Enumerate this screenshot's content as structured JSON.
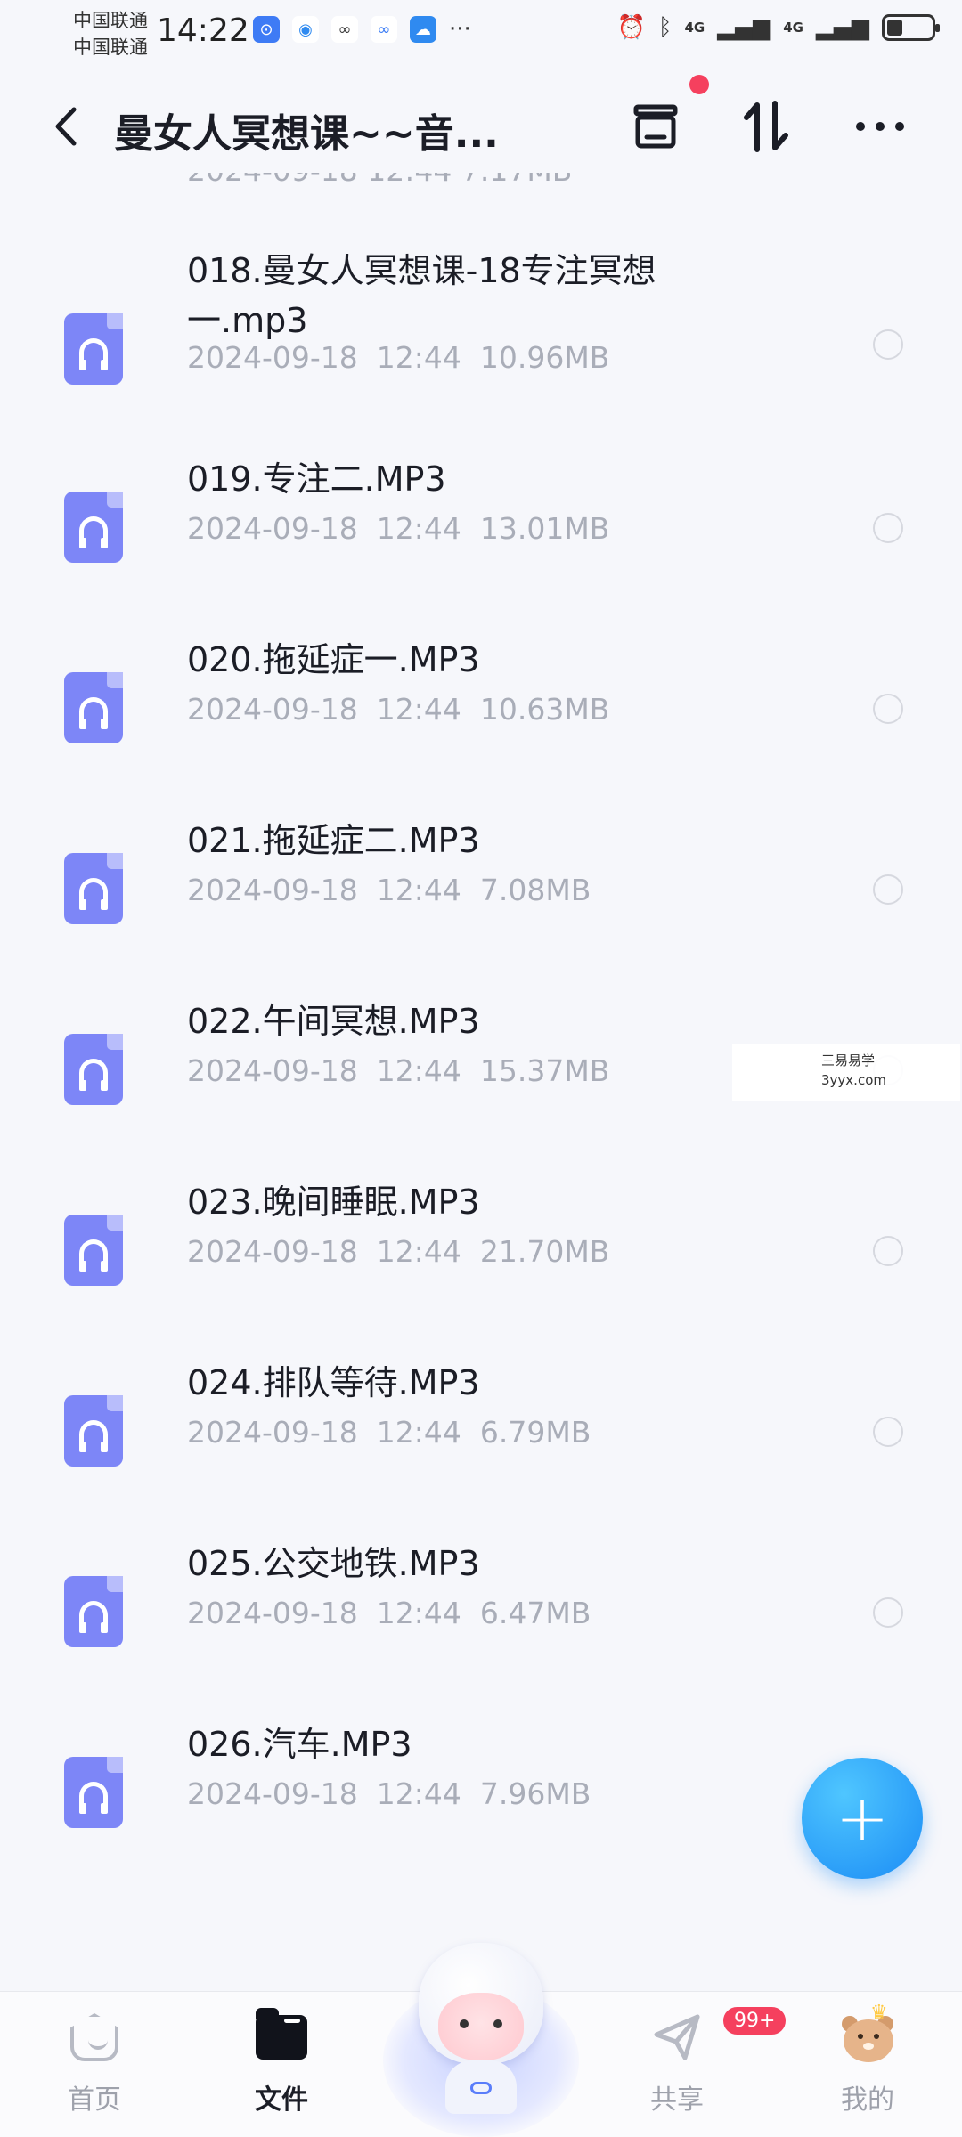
{
  "status_bar": {
    "carrier_1": "中国联通",
    "carrier_2": "中国联通",
    "time": "14:22",
    "network_1": "4G",
    "network_2": "4G",
    "battery_level": 0.35,
    "app_icons": [
      "browser-app-icon",
      "blue-circle-app-icon",
      "cloud-app-icon",
      "cloud-app-icon-2",
      "weather-app-icon"
    ],
    "overflow": "···"
  },
  "header": {
    "back_icon": "chevron-left-icon",
    "title": "曼女人冥想课~~音...",
    "inbox_icon": "inbox-icon",
    "sort_icon": "sort-icon",
    "more_icon": "more-icon"
  },
  "clipped_row_meta": "2024-09-18  12:44  7.17MB",
  "files": [
    {
      "name": "018.曼女人冥想课-18专注冥想一.mp3",
      "date": "2024-09-18",
      "time": "12:44",
      "size": "10.96MB"
    },
    {
      "name": "019.专注二.MP3",
      "date": "2024-09-18",
      "time": "12:44",
      "size": "13.01MB"
    },
    {
      "name": "020.拖延症一.MP3",
      "date": "2024-09-18",
      "time": "12:44",
      "size": "10.63MB"
    },
    {
      "name": "021.拖延症二.MP3",
      "date": "2024-09-18",
      "time": "12:44",
      "size": "7.08MB"
    },
    {
      "name": "022.午间冥想.MP3",
      "date": "2024-09-18",
      "time": "12:44",
      "size": "15.37MB"
    },
    {
      "name": "023.晚间睡眠.MP3",
      "date": "2024-09-18",
      "time": "12:44",
      "size": "21.70MB"
    },
    {
      "name": "024.排队等待.MP3",
      "date": "2024-09-18",
      "time": "12:44",
      "size": "6.79MB"
    },
    {
      "name": "025.公交地铁.MP3",
      "date": "2024-09-18",
      "time": "12:44",
      "size": "6.47MB"
    },
    {
      "name": "026.汽车.MP3",
      "date": "2024-09-18",
      "time": "12:44",
      "size": "7.96MB"
    }
  ],
  "watermark": {
    "line1": "三易易学",
    "line2": "3yyx.com"
  },
  "fab": {
    "icon": "plus-icon",
    "label": "+"
  },
  "bottom_nav": {
    "items": [
      {
        "label": "首页",
        "icon": "home-icon",
        "active": false
      },
      {
        "label": "文件",
        "icon": "folder-icon",
        "active": true
      },
      {
        "label": "共享",
        "icon": "share-plane-icon",
        "active": false,
        "badge": "99+"
      },
      {
        "label": "我的",
        "icon": "bear-avatar-icon",
        "active": false
      }
    ]
  },
  "colors": {
    "accent": "#1b8cf5",
    "file_icon": "#7d86f7",
    "badge": "#f5405e",
    "meta_text": "#a9adb8"
  }
}
